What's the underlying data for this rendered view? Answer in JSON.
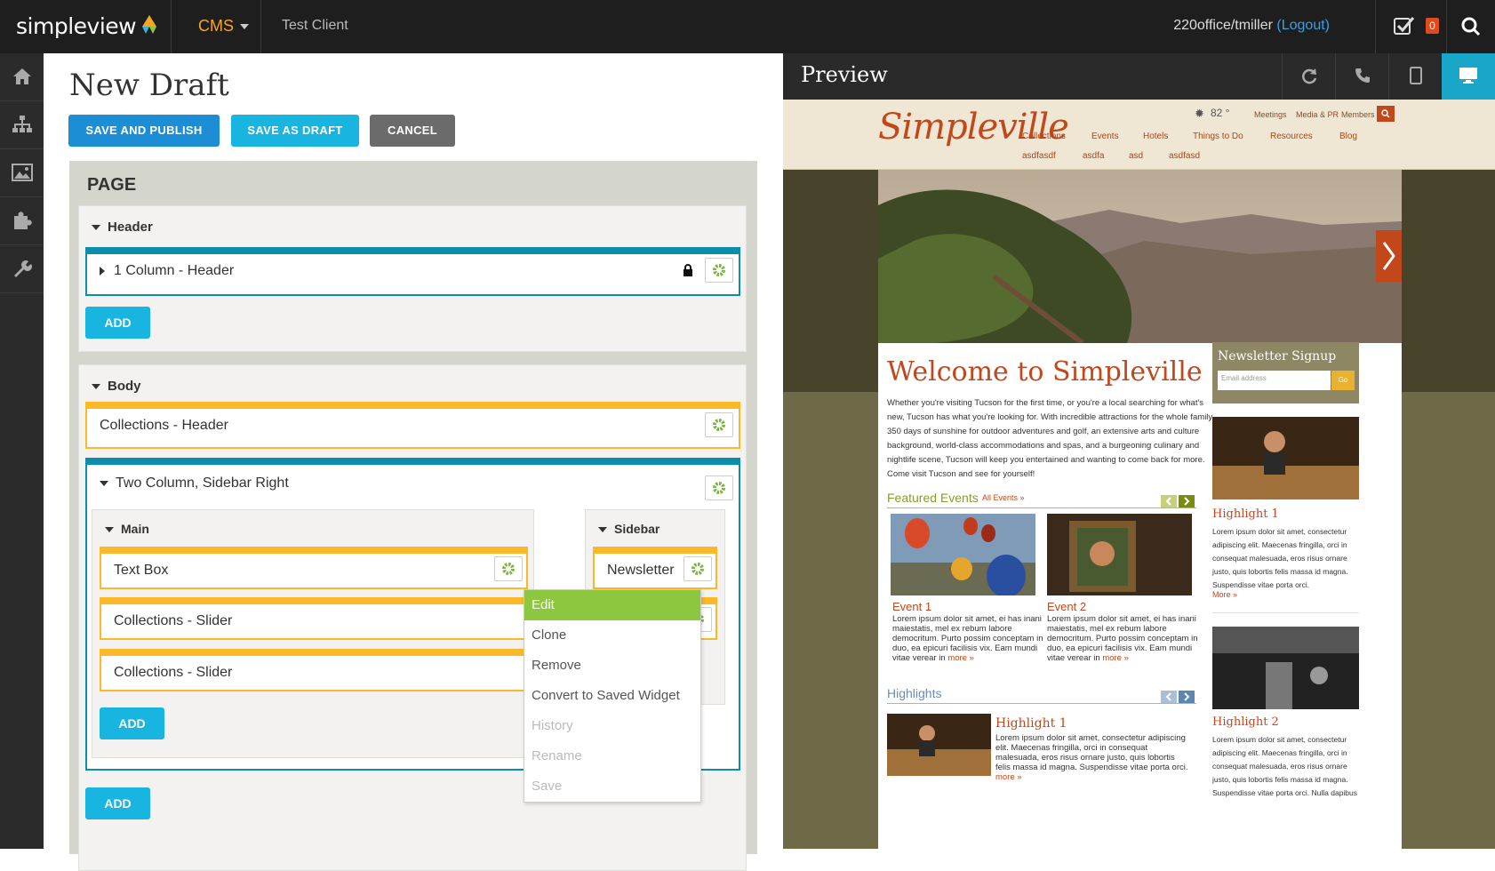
{
  "topbar": {
    "logo": "simpleview",
    "cms_label": "CMS",
    "client": "Test Client",
    "user": "220office/tmiller",
    "logout": "(Logout)",
    "notification_count": "0"
  },
  "sidenav": [
    "home-icon",
    "sitemap-icon",
    "image-icon",
    "puzzle-icon",
    "wrench-icon"
  ],
  "editor": {
    "title": "New Draft",
    "buttons": {
      "publish": "SAVE AND PUBLISH",
      "draft": "SAVE AS DRAFT",
      "cancel": "CANCEL"
    },
    "page_label": "PAGE",
    "header_section": {
      "label": "Header",
      "widget": "1 Column - Header",
      "add": "ADD"
    },
    "body_section": {
      "label": "Body",
      "widgets": {
        "collections_header": "Collections - Header",
        "two_column": "Two Column, Sidebar Right",
        "main_label": "Main",
        "sidebar_label": "Sidebar",
        "text_box": "Text Box",
        "slider1": "Collections - Slider",
        "slider2": "Collections - Slider",
        "newsletter": "Newsletter"
      },
      "inner_add": "ADD",
      "outer_add": "ADD"
    },
    "context_menu": [
      "Edit",
      "Clone",
      "Remove",
      "Convert to Saved Widget",
      "History",
      "Rename",
      "Save"
    ]
  },
  "preview": {
    "title": "Preview",
    "site": {
      "logo": "Simpleville",
      "weather": "82 °",
      "top_links": [
        "Meetings",
        "Media & PR",
        "Members"
      ],
      "nav1": [
        "Collections",
        "Events",
        "Hotels",
        "Things to Do",
        "Resources",
        "Blog"
      ],
      "nav2": [
        "asdfasdf",
        "asdfa",
        "asd",
        "asdfasd"
      ],
      "welcome": "Welcome to Simpleville",
      "intro": "Whether you're visiting Tucson for the first time, or you're a local searching for what's new, Tucson has what you're looking for. With incredible attractions for the whole family, 350 days of sunshine for outdoor adventures and golf, an extensive arts and culture background, world-class accommodations and spas, and a burgeoning culinary and nightlife scene, Tucson will keep you entertained and wanting to come back for more. Come visit Tucson and see for yourself!",
      "featured_events": "Featured Events",
      "all_events": "All Events »",
      "event1": "Event 1",
      "event2": "Event 2",
      "event_text": "Lorem ipsum dolor sit amet, ei has inani maiestatis, mel ex rebum labore democritum. Purto possim conceptam in duo, ea epicuri facilisis vix. Eam mundi vitae verear in",
      "more": "more »",
      "highlights": "Highlights",
      "highlight1": "Highlight 1",
      "highlight_text": "Lorem ipsum dolor sit amet, consectetur adipiscing elit. Maecenas fringilla, orci in consequat malesuada, eros risus ornare justo, quis lobortis felis massa id magna. Suspendisse vitae porta orci.",
      "newsletter_title": "Newsletter Signup",
      "email_placeholder": "Email address",
      "go": "Go",
      "sb_highlight1": "Highlight 1",
      "sb_highlight2": "Highlight 2",
      "sb_text": "Lorem ipsum dolor sit amet, consectetur adipiscing elit. Maecenas fringilla, orci in consequat malesuada, eros risus ornare justo, quis lobortis felis massa id magna. Suspendisse vitae porta orci.",
      "sb_text2": "Lorem ipsum dolor sit amet, consectetur adipiscing elit. Maecenas fringilla, orci in consequat malesuada, eros risus ornare justo, quis lobortis felis massa id magna. Suspendisse vitae porta orci. Nulla dapibus",
      "sb_more": "More »"
    }
  },
  "colors": {
    "teal": "#0c8eaa",
    "orange": "#fbb829",
    "blue_btn": "#1b8ed6",
    "cyan_btn": "#18b5e0",
    "gray_btn": "#6b6b6b",
    "menu_active": "#8dc63f",
    "brand_red": "#c2471b",
    "olive": "#6e6a47"
  }
}
